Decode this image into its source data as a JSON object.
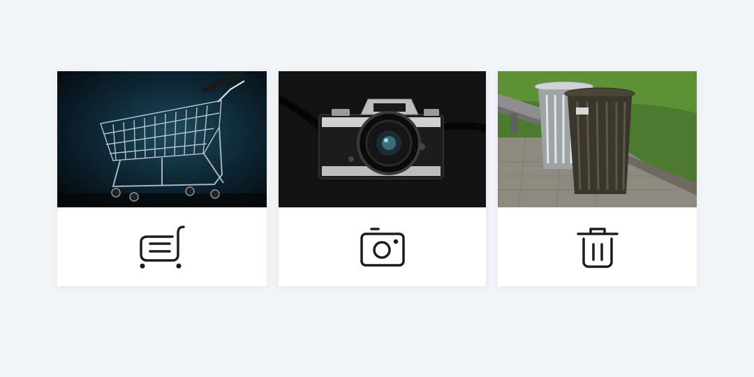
{
  "cards": [
    {
      "photo": "shopping-cart-photo",
      "icon": "shopping-cart-icon",
      "icon_color": "#1b1b22"
    },
    {
      "photo": "camera-photo",
      "icon": "camera-icon",
      "icon_color": "#1b1b22"
    },
    {
      "photo": "trash-bin-photo",
      "icon": "trash-icon",
      "icon_color": "#1b1b22"
    }
  ],
  "colors": {
    "page_background": "#f3f4f8",
    "card_background": "#ffffff"
  }
}
